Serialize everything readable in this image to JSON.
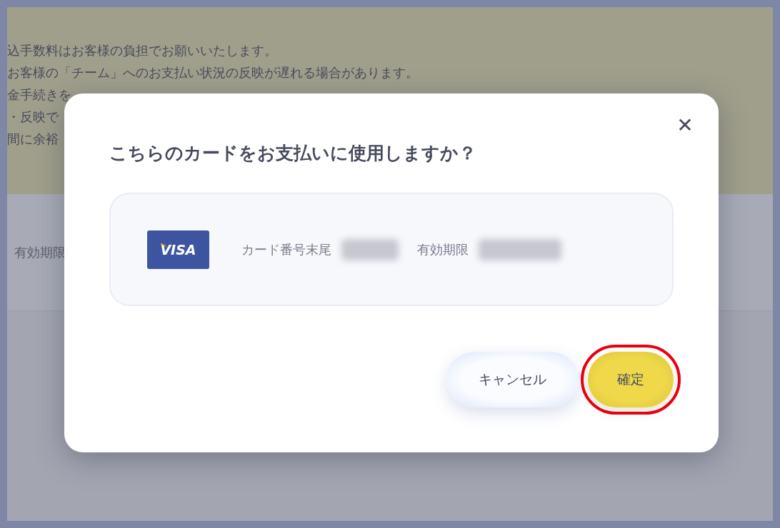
{
  "notice": {
    "lines": [
      "込手数料はお客様の負担でお願いいたします。",
      "お客様の「チーム」へのお支払い状況の反映が遅れる場合があります。",
      "金手続きを",
      "・反映で",
      "間に余裕"
    ]
  },
  "background_row": {
    "label": "有効期限"
  },
  "dialog": {
    "title": "こちらのカードをお支払いに使用しますか？",
    "close": "✕",
    "card": {
      "brand": "VISA",
      "number_label": "カード番号末尾",
      "expiry_label": "有効期限"
    },
    "buttons": [
      {
        "label": "キャンセル",
        "kind": "secondary",
        "highlighted": false
      },
      {
        "label": "確定",
        "kind": "primary",
        "highlighted": true
      }
    ]
  }
}
